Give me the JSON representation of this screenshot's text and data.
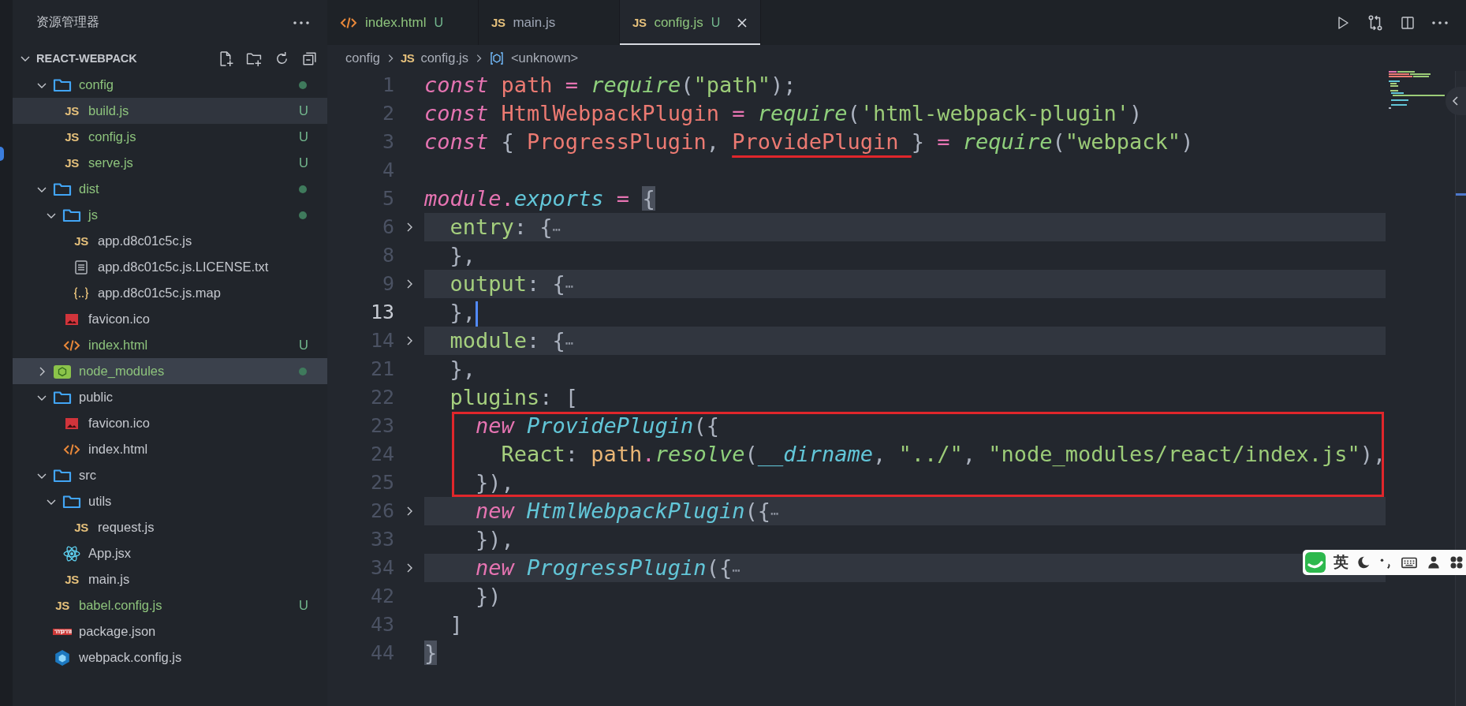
{
  "sidebar": {
    "title": "资源管理器",
    "workspace": {
      "name": "REACT-WEBPACK",
      "expanded": true
    },
    "tree": [
      {
        "name": "config",
        "kind": "folder",
        "expanded": true,
        "untracked": true,
        "dot": true,
        "selected": false,
        "hovered": false,
        "children": [
          {
            "name": "build.js",
            "kind": "js",
            "icon_text": "JS",
            "untracked": true,
            "status": "U",
            "dot": false,
            "selected": false,
            "hovered": true
          },
          {
            "name": "config.js",
            "kind": "js",
            "icon_text": "JS",
            "untracked": true,
            "status": "U",
            "dot": false,
            "selected": false,
            "hovered": false
          },
          {
            "name": "serve.js",
            "kind": "js",
            "icon_text": "JS",
            "untracked": true,
            "status": "U",
            "dot": false,
            "selected": false,
            "hovered": false
          }
        ]
      },
      {
        "name": "dist",
        "kind": "folder",
        "expanded": true,
        "untracked": true,
        "dot": true,
        "selected": false,
        "hovered": false,
        "children": [
          {
            "name": "js",
            "kind": "folder",
            "expanded": true,
            "untracked": true,
            "dot": true,
            "selected": false,
            "hovered": false,
            "children": [
              {
                "name": "app.d8c01c5c.js",
                "kind": "js",
                "icon_text": "JS",
                "untracked": false,
                "dot": false,
                "selected": false,
                "hovered": false
              },
              {
                "name": "app.d8c01c5c.js.LICENSE.txt",
                "kind": "text",
                "untracked": false,
                "dot": false,
                "selected": false,
                "hovered": false
              },
              {
                "name": "app.d8c01c5c.js.map",
                "kind": "json",
                "untracked": false,
                "dot": false,
                "selected": false,
                "hovered": false
              }
            ]
          },
          {
            "name": "favicon.ico",
            "kind": "image",
            "untracked": false,
            "dot": false,
            "selected": false,
            "hovered": false
          },
          {
            "name": "index.html",
            "kind": "html",
            "untracked": true,
            "status": "U",
            "dot": false,
            "selected": false,
            "hovered": false
          }
        ]
      },
      {
        "name": "node_modules",
        "kind": "node-folder",
        "expanded": false,
        "untracked": true,
        "dot": true,
        "selected": true,
        "hovered": false
      },
      {
        "name": "public",
        "kind": "folder",
        "expanded": true,
        "untracked": false,
        "dot": false,
        "selected": false,
        "hovered": false,
        "children": [
          {
            "name": "favicon.ico",
            "kind": "image",
            "untracked": false,
            "dot": false,
            "selected": false,
            "hovered": false
          },
          {
            "name": "index.html",
            "kind": "html",
            "untracked": false,
            "dot": false,
            "selected": false,
            "hovered": false
          }
        ]
      },
      {
        "name": "src",
        "kind": "folder",
        "expanded": true,
        "untracked": false,
        "dot": false,
        "selected": false,
        "hovered": false,
        "children": [
          {
            "name": "utils",
            "kind": "folder",
            "expanded": true,
            "untracked": false,
            "dot": false,
            "selected": false,
            "hovered": false,
            "children": [
              {
                "name": "request.js",
                "kind": "js",
                "icon_text": "JS",
                "untracked": false,
                "dot": false,
                "selected": false,
                "hovered": false
              }
            ]
          },
          {
            "name": "App.jsx",
            "kind": "react",
            "untracked": false,
            "dot": false,
            "selected": false,
            "hovered": false
          },
          {
            "name": "main.js",
            "kind": "js",
            "icon_text": "JS",
            "untracked": false,
            "dot": false,
            "selected": false,
            "hovered": false
          }
        ]
      },
      {
        "name": "babel.config.js",
        "kind": "js",
        "icon_text": "JS",
        "untracked": true,
        "status": "U",
        "dot": false,
        "selected": false,
        "hovered": false
      },
      {
        "name": "package.json",
        "kind": "npm",
        "untracked": false,
        "dot": false,
        "selected": false,
        "hovered": false
      },
      {
        "name": "webpack.config.js",
        "kind": "webpack",
        "untracked": false,
        "dot": false,
        "selected": false,
        "hovered": false
      }
    ]
  },
  "tabs": [
    {
      "label": "index.html",
      "kind": "html",
      "untracked": true,
      "status": "U",
      "selected": false
    },
    {
      "label": "main.js",
      "kind": "js",
      "icon_text": "JS",
      "untracked": false,
      "selected": false
    },
    {
      "label": "config.js",
      "kind": "js",
      "icon_text": "JS",
      "untracked": true,
      "status": "U",
      "selected": true
    }
  ],
  "breadcrumb": [
    {
      "kind": "plain",
      "label": "config"
    },
    {
      "kind": "js",
      "icon_text": "JS",
      "label": "config.js"
    },
    {
      "kind": "symbol",
      "label": "<unknown>"
    }
  ],
  "editor": {
    "lines": [
      {
        "number": "1",
        "folded": false,
        "current": false,
        "boxed": false,
        "tokens": [
          {
            "kind": "keyword",
            "text": "const "
          },
          {
            "kind": "var",
            "text": "path "
          },
          {
            "kind": "op",
            "text": "= "
          },
          {
            "kind": "fn",
            "text": "require"
          },
          {
            "kind": "punct",
            "text": "("
          },
          {
            "kind": "str",
            "text": "\"path\""
          },
          {
            "kind": "punct",
            "text": ");"
          }
        ]
      },
      {
        "number": "2",
        "folded": false,
        "current": false,
        "boxed": false,
        "tokens": [
          {
            "kind": "keyword",
            "text": "const "
          },
          {
            "kind": "var",
            "text": "HtmlWebpackPlugin "
          },
          {
            "kind": "op",
            "text": "= "
          },
          {
            "kind": "fn",
            "text": "require"
          },
          {
            "kind": "punct",
            "text": "("
          },
          {
            "kind": "str",
            "text": "'html-webpack-plugin'"
          },
          {
            "kind": "punct",
            "text": ")"
          }
        ]
      },
      {
        "number": "3",
        "folded": false,
        "current": false,
        "boxed": false,
        "tokens": [
          {
            "kind": "keyword",
            "text": "const "
          },
          {
            "kind": "punct",
            "text": "{ "
          },
          {
            "kind": "var",
            "text": "ProgressPlugin"
          },
          {
            "kind": "punct",
            "text": ", "
          },
          {
            "kind": "var",
            "text": "ProvidePlugin ",
            "underline": true
          },
          {
            "kind": "punct",
            "text": "} "
          },
          {
            "kind": "op",
            "text": "= "
          },
          {
            "kind": "fn",
            "text": "require"
          },
          {
            "kind": "punct",
            "text": "("
          },
          {
            "kind": "str",
            "text": "\"webpack\""
          },
          {
            "kind": "punct",
            "text": ")"
          }
        ]
      },
      {
        "number": "4",
        "current": false
      },
      {
        "number": "5",
        "folded": false,
        "current": false,
        "boxed": false,
        "tokens": [
          {
            "kind": "keyword",
            "text": "module"
          },
          {
            "kind": "op",
            "text": "."
          },
          {
            "kind": "param",
            "text": "exports "
          },
          {
            "kind": "op",
            "text": "= "
          },
          {
            "kind": "bracket",
            "text": "{"
          }
        ]
      },
      {
        "number": "6",
        "folded": true,
        "current": false,
        "boxed": false,
        "tokens": [
          {
            "kind": "prop",
            "text": "  entry"
          },
          {
            "kind": "punct",
            "text": ": {"
          },
          {
            "kind": "ellipsis",
            "text": "⋯"
          }
        ]
      },
      {
        "number": "8",
        "folded": false,
        "current": false,
        "boxed": false,
        "tokens": [
          {
            "kind": "punct",
            "text": "  },"
          }
        ]
      },
      {
        "number": "9",
        "folded": true,
        "current": false,
        "boxed": false,
        "tokens": [
          {
            "kind": "prop",
            "text": "  output"
          },
          {
            "kind": "punct",
            "text": ": {"
          },
          {
            "kind": "ellipsis",
            "text": "⋯"
          }
        ]
      },
      {
        "number": "13",
        "folded": false,
        "current": true,
        "boxed": false,
        "tokens": [
          {
            "kind": "punct",
            "text": "  },"
          }
        ]
      },
      {
        "number": "14",
        "folded": true,
        "current": false,
        "boxed": false,
        "tokens": [
          {
            "kind": "prop",
            "text": "  module"
          },
          {
            "kind": "punct",
            "text": ": {"
          },
          {
            "kind": "ellipsis",
            "text": "⋯"
          }
        ]
      },
      {
        "number": "21",
        "folded": false,
        "current": false,
        "boxed": false,
        "tokens": [
          {
            "kind": "punct",
            "text": "  },"
          }
        ]
      },
      {
        "number": "22",
        "folded": false,
        "current": false,
        "boxed": false,
        "tokens": [
          {
            "kind": "prop",
            "text": "  plugins"
          },
          {
            "kind": "punct",
            "text": ": ["
          }
        ]
      },
      {
        "number": "23",
        "folded": false,
        "current": false,
        "boxed": true,
        "tokens": [
          {
            "kind": "keyword",
            "text": "    new "
          },
          {
            "kind": "cls",
            "text": "ProvidePlugin"
          },
          {
            "kind": "punct",
            "text": "({"
          }
        ]
      },
      {
        "number": "24",
        "folded": false,
        "current": false,
        "boxed": true,
        "tokens": [
          {
            "kind": "prop",
            "text": "      React"
          },
          {
            "kind": "punct",
            "text": ": "
          },
          {
            "kind": "obj",
            "text": "path"
          },
          {
            "kind": "op",
            "text": "."
          },
          {
            "kind": "fn",
            "text": "resolve"
          },
          {
            "kind": "punct",
            "text": "("
          },
          {
            "kind": "param",
            "text": "__dirname"
          },
          {
            "kind": "punct",
            "text": ", "
          },
          {
            "kind": "str",
            "text": "\"../\""
          },
          {
            "kind": "punct",
            "text": ", "
          },
          {
            "kind": "str",
            "text": "\"node_modules/react/index.js\""
          },
          {
            "kind": "punct",
            "text": "),"
          }
        ]
      },
      {
        "number": "25",
        "folded": false,
        "current": false,
        "boxed": true,
        "tokens": [
          {
            "kind": "punct",
            "text": "    }),"
          }
        ]
      },
      {
        "number": "26",
        "folded": true,
        "current": false,
        "boxed": false,
        "tokens": [
          {
            "kind": "keyword",
            "text": "    new "
          },
          {
            "kind": "cls",
            "text": "HtmlWebpackPlugin"
          },
          {
            "kind": "punct",
            "text": "({"
          },
          {
            "kind": "ellipsis",
            "text": "⋯"
          }
        ]
      },
      {
        "number": "33",
        "folded": false,
        "current": false,
        "boxed": false,
        "tokens": [
          {
            "kind": "punct",
            "text": "    }),"
          }
        ]
      },
      {
        "number": "34",
        "folded": true,
        "current": false,
        "boxed": false,
        "tokens": [
          {
            "kind": "keyword",
            "text": "    new "
          },
          {
            "kind": "cls",
            "text": "ProgressPlugin"
          },
          {
            "kind": "punct",
            "text": "({"
          },
          {
            "kind": "ellipsis",
            "text": "⋯"
          }
        ]
      },
      {
        "number": "42",
        "folded": false,
        "current": false,
        "boxed": false,
        "tokens": [
          {
            "kind": "punct",
            "text": "    })"
          }
        ]
      },
      {
        "number": "43",
        "folded": false,
        "current": false,
        "boxed": false,
        "tokens": [
          {
            "kind": "punct",
            "text": "  ]"
          }
        ]
      },
      {
        "number": "44",
        "folded": false,
        "current": false,
        "boxed": false,
        "tokens": [
          {
            "kind": "bracket",
            "text": "}"
          }
        ]
      }
    ]
  },
  "ime": {
    "mode": "英"
  }
}
